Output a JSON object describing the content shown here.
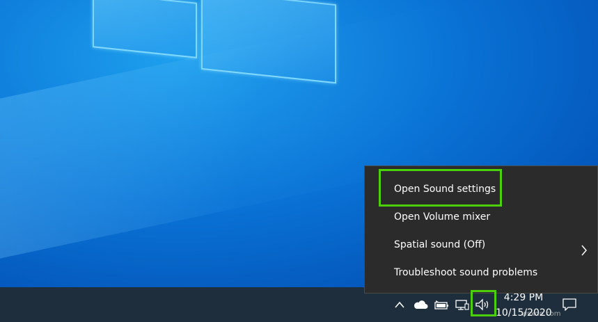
{
  "context_menu": {
    "items": [
      {
        "label": "Open Sound settings"
      },
      {
        "label": "Open Volume mixer"
      },
      {
        "label": "Spatial sound (Off)"
      },
      {
        "label": "Troubleshoot sound problems"
      }
    ]
  },
  "clock": {
    "time": "4:29 PM",
    "date": "10/15/2020"
  },
  "tray": {
    "icons": [
      "chevron-up-icon",
      "onedrive-cloud-icon",
      "battery-icon",
      "network-icon",
      "speaker-icon"
    ]
  },
  "watermark": "wsxdn.com",
  "colors": {
    "highlight": "#4cd00c",
    "menu_bg": "#2b2b2b",
    "taskbar_bg": "#1f2e3c"
  }
}
